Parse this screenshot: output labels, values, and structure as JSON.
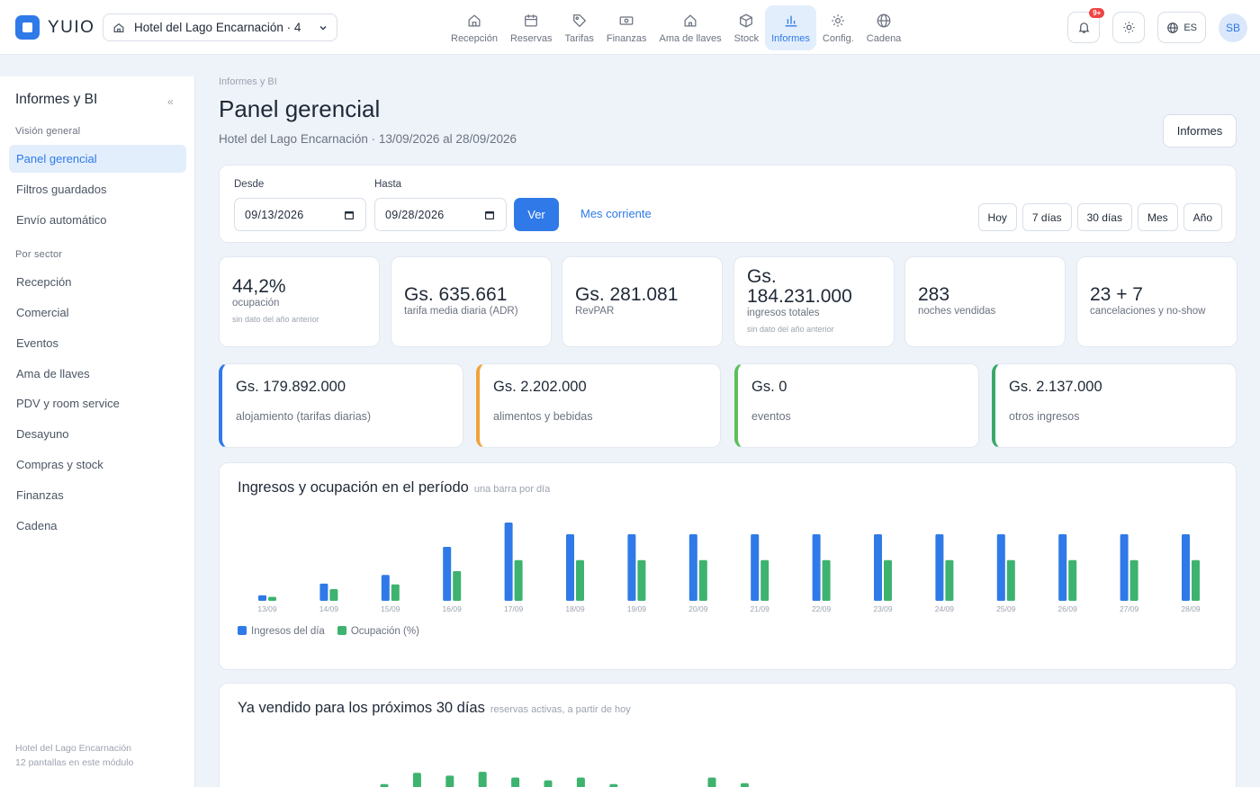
{
  "app": {
    "name": "YUIO"
  },
  "hotel_select": {
    "label": "Hotel del Lago Encarnación · 4"
  },
  "nav": [
    {
      "label": "Recepción",
      "icon": "home-icon",
      "active": false
    },
    {
      "label": "Reservas",
      "icon": "calendar-icon",
      "active": false
    },
    {
      "label": "Tarifas",
      "icon": "tag-icon",
      "active": false
    },
    {
      "label": "Finanzas",
      "icon": "cash-icon",
      "active": false
    },
    {
      "label": "Ama de llaves",
      "icon": "house-icon",
      "active": false
    },
    {
      "label": "Stock",
      "icon": "box-icon",
      "active": false
    },
    {
      "label": "Informes",
      "icon": "bar-chart-icon",
      "active": true
    },
    {
      "label": "Config.",
      "icon": "gear-icon",
      "active": false
    },
    {
      "label": "Cadena",
      "icon": "globe-icon",
      "active": false
    }
  ],
  "header": {
    "notifications_badge": "9+",
    "language": "ES",
    "user_initials": "SB"
  },
  "sidebar": {
    "title": "Informes y BI",
    "collapse": "«",
    "section_overview": "Visión general",
    "overview_items": [
      "Panel gerencial",
      "Filtros guardados",
      "Envío automático"
    ],
    "section_sector": "Por sector",
    "sector_items": [
      "Recepción",
      "Comercial",
      "Eventos",
      "Ama de llaves",
      "PDV y room service",
      "Desayuno",
      "Compras y stock",
      "Finanzas",
      "Cadena"
    ],
    "footer_hotel": "Hotel del Lago Encarnación",
    "footer_count": "12 pantallas en este módulo"
  },
  "page": {
    "breadcrumb": "Informes y BI",
    "title": "Panel gerencial",
    "subtitle": "Hotel del Lago Encarnación · 13/09/2026 al 28/09/2026",
    "reports_button": "Informes"
  },
  "filter": {
    "from_label": "Desde",
    "from_value": "09/13/2026",
    "to_label": "Hasta",
    "to_value": "09/28/2026",
    "submit": "Ver",
    "current_month": "Mes corriente",
    "ranges": [
      "Hoy",
      "7 días",
      "30 días",
      "Mes",
      "Año"
    ]
  },
  "kpis": [
    {
      "value": "44,2%",
      "label": "ocupación",
      "note": "sin dato del año anterior"
    },
    {
      "value": "Gs. 635.661",
      "label": "tarifa media diaria (ADR)",
      "note": ""
    },
    {
      "value": "Gs. 281.081",
      "label": "RevPAR",
      "note": ""
    },
    {
      "value": "Gs. 184.231.000",
      "label": "ingresos totales",
      "note": "sin dato del año anterior"
    },
    {
      "value": "283",
      "label": "noches vendidas",
      "note": ""
    },
    {
      "value": "23 + 7",
      "label": "cancelaciones y no-show",
      "note": ""
    }
  ],
  "revenue": [
    {
      "value": "Gs. 179.892.000",
      "label": "alojamiento (tarifas diarias)",
      "color": "#2f7ae8"
    },
    {
      "value": "Gs. 2.202.000",
      "label": "alimentos y bebidas",
      "color": "#f0a33a"
    },
    {
      "value": "Gs. 0",
      "label": "eventos",
      "color": "#5cbf5c"
    },
    {
      "value": "Gs. 2.137.000",
      "label": "otros ingresos",
      "color": "#3aa86b"
    }
  ],
  "chart1": {
    "title": "Ingresos y ocupación en el período",
    "hint": "una barra por día",
    "legend": [
      "Ingresos del día",
      "Ocupación (%)"
    ]
  },
  "chart2": {
    "title": "Ya vendido para los próximos 30 días",
    "hint": "reservas activas, a partir de hoy"
  },
  "chart_data": [
    {
      "type": "bar",
      "title": "Ingresos y ocupación en el período",
      "categories": [
        "13/09",
        "14/09",
        "15/09",
        "16/09",
        "17/09",
        "18/09",
        "19/09",
        "20/09",
        "21/09",
        "22/09",
        "23/09",
        "24/09",
        "25/09",
        "26/09",
        "27/09",
        "28/09"
      ],
      "series": [
        {
          "name": "Ingresos del día",
          "color": "#2f7ae8",
          "values": [
            7,
            22,
            33,
            69,
            100,
            85,
            85,
            85,
            85,
            85,
            85,
            85,
            85,
            85,
            85,
            85
          ]
        },
        {
          "name": "Ocupación (%)",
          "color": "#3db36f",
          "values": [
            5,
            15,
            21,
            38,
            52,
            52,
            52,
            52,
            52,
            52,
            52,
            52,
            52,
            52,
            52,
            52
          ]
        }
      ],
      "ylim": [
        0,
        100
      ],
      "grid": false,
      "legend": "bottom-left"
    },
    {
      "type": "bar",
      "title": "Ya vendido para los próximos 30 días",
      "series": [
        {
          "color": "#3db36f",
          "values": [
            4,
            16,
            13,
            17,
            11,
            8,
            11,
            4,
            0,
            0,
            11,
            5
          ]
        }
      ],
      "grid": false
    }
  ]
}
